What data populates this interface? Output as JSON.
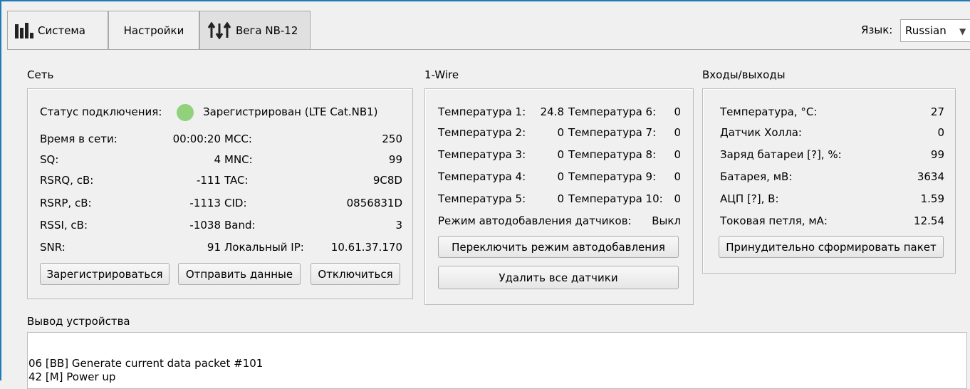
{
  "tabs": [
    {
      "label": "Система",
      "icon": "bar-chart-icon"
    },
    {
      "label": "Настройки"
    },
    {
      "label": "Вега NB-12",
      "icon": "sort-arrows-icon"
    }
  ],
  "language": {
    "label": "Язык:",
    "selected": "Russian"
  },
  "network": {
    "title": "Сеть",
    "status_label": "Статус подключения:",
    "status_value": "Зарегистрирован (LTE Cat.NB1)",
    "status_color": "#92d17b",
    "rows_left": [
      {
        "label": "Время в сети:",
        "value": "00:00:20"
      },
      {
        "label": "SQ:",
        "value": "4"
      },
      {
        "label": "RSRQ, cB:",
        "value": "-111"
      },
      {
        "label": "RSRP, cB:",
        "value": "-1113"
      },
      {
        "label": "RSSI, cB:",
        "value": "-1038"
      },
      {
        "label": "SNR:",
        "value": "91"
      }
    ],
    "rows_right": [
      {
        "label": "MCC:",
        "value": "250"
      },
      {
        "label": "MNC:",
        "value": "99"
      },
      {
        "label": "TAC:",
        "value": "9C8D"
      },
      {
        "label": "CID:",
        "value": "0856831D"
      },
      {
        "label": "Band:",
        "value": "3"
      },
      {
        "label": "Локальный IP:",
        "value": "10.61.37.170"
      }
    ],
    "buttons": {
      "register": "Зарегистрироваться",
      "send": "Отправить данные",
      "disconnect": "Отключиться"
    }
  },
  "onewire": {
    "title": "1-Wire",
    "left": [
      {
        "label": "Температура 1:",
        "value": "24.8"
      },
      {
        "label": "Температура 2:",
        "value": "0"
      },
      {
        "label": "Температура 3:",
        "value": "0"
      },
      {
        "label": "Температура 4:",
        "value": "0"
      },
      {
        "label": "Температура 5:",
        "value": "0"
      }
    ],
    "right": [
      {
        "label": "Температура 6:",
        "value": "0"
      },
      {
        "label": "Температура 7:",
        "value": "0"
      },
      {
        "label": "Температура 8:",
        "value": "0"
      },
      {
        "label": "Температура 9:",
        "value": "0"
      },
      {
        "label": "Температура 10:",
        "value": "0"
      }
    ],
    "autoadd_label": "Режим автодобавления датчиков:",
    "autoadd_value": "Выкл",
    "buttons": {
      "toggle": "Переключить режим автодобавления",
      "delete_all": "Удалить все датчики"
    }
  },
  "io": {
    "title": "Входы/выходы",
    "rows": [
      {
        "label": "Температура, °C:",
        "value": "27"
      },
      {
        "label": "Датчик Холла:",
        "value": "0"
      },
      {
        "label": "Заряд батареи [?], %:",
        "value": "99"
      },
      {
        "label": "Батарея, мВ:",
        "value": "3634"
      },
      {
        "label": "АЦП [?], В:",
        "value": "1.59"
      },
      {
        "label": "Токовая петля, мА:",
        "value": "12.54"
      }
    ],
    "button": "Принудительно сформировать пакет"
  },
  "output": {
    "title": "Вывод устройства",
    "lines": [
      "06 [BB] Generate current data packet #101",
      "42 [M]  Power up"
    ]
  }
}
